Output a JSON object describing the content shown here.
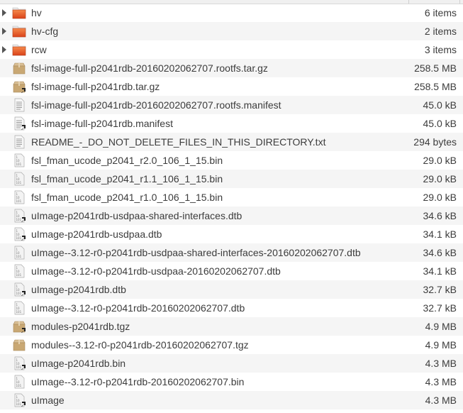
{
  "files": [
    {
      "name": "hv",
      "size": "6 items",
      "type": "folder",
      "link": false
    },
    {
      "name": "hv-cfg",
      "size": "2 items",
      "type": "folder",
      "link": false
    },
    {
      "name": "rcw",
      "size": "3 items",
      "type": "folder",
      "link": false
    },
    {
      "name": "fsl-image-full-p2041rdb-20160202062707.rootfs.tar.gz",
      "size": "258.5 MB",
      "type": "archive",
      "link": false
    },
    {
      "name": "fsl-image-full-p2041rdb.tar.gz",
      "size": "258.5 MB",
      "type": "archive",
      "link": true
    },
    {
      "name": "fsl-image-full-p2041rdb-20160202062707.rootfs.manifest",
      "size": "45.0 kB",
      "type": "text",
      "link": false
    },
    {
      "name": "fsl-image-full-p2041rdb.manifest",
      "size": "45.0 kB",
      "type": "text",
      "link": true
    },
    {
      "name": "README_-_DO_NOT_DELETE_FILES_IN_THIS_DIRECTORY.txt",
      "size": "294 bytes",
      "type": "text",
      "link": false
    },
    {
      "name": "fsl_fman_ucode_p2041_r2.0_106_1_15.bin",
      "size": "29.0 kB",
      "type": "binary",
      "link": false
    },
    {
      "name": "fsl_fman_ucode_p2041_r1.1_106_1_15.bin",
      "size": "29.0 kB",
      "type": "binary",
      "link": false
    },
    {
      "name": "fsl_fman_ucode_p2041_r1.0_106_1_15.bin",
      "size": "29.0 kB",
      "type": "binary",
      "link": false
    },
    {
      "name": "uImage-p2041rdb-usdpaa-shared-interfaces.dtb",
      "size": "34.6 kB",
      "type": "binary",
      "link": true
    },
    {
      "name": "uImage-p2041rdb-usdpaa.dtb",
      "size": "34.1 kB",
      "type": "binary",
      "link": true
    },
    {
      "name": "uImage--3.12-r0-p2041rdb-usdpaa-shared-interfaces-20160202062707.dtb",
      "size": "34.6 kB",
      "type": "binary",
      "link": false
    },
    {
      "name": "uImage--3.12-r0-p2041rdb-usdpaa-20160202062707.dtb",
      "size": "34.1 kB",
      "type": "binary",
      "link": false
    },
    {
      "name": "uImage-p2041rdb.dtb",
      "size": "32.7 kB",
      "type": "binary",
      "link": true
    },
    {
      "name": "uImage--3.12-r0-p2041rdb-20160202062707.dtb",
      "size": "32.7 kB",
      "type": "binary",
      "link": false
    },
    {
      "name": "modules-p2041rdb.tgz",
      "size": "4.9 MB",
      "type": "archive",
      "link": true
    },
    {
      "name": "modules--3.12-r0-p2041rdb-20160202062707.tgz",
      "size": "4.9 MB",
      "type": "archive",
      "link": false
    },
    {
      "name": "uImage-p2041rdb.bin",
      "size": "4.3 MB",
      "type": "binary",
      "link": true
    },
    {
      "name": "uImage--3.12-r0-p2041rdb-20160202062707.bin",
      "size": "4.3 MB",
      "type": "binary",
      "link": false
    },
    {
      "name": "uImage",
      "size": "4.3 MB",
      "type": "binary",
      "link": true
    }
  ]
}
